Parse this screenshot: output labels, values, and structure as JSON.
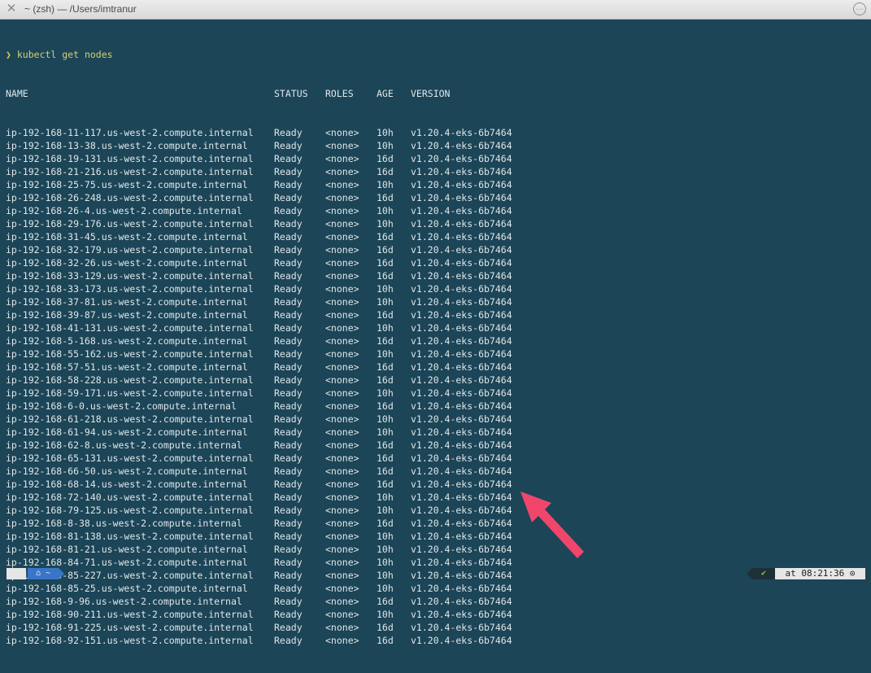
{
  "window": {
    "title": "~ (zsh) — /Users/imtranur",
    "close_glyph": "✕",
    "more_glyph": "…"
  },
  "prompt": {
    "glyph": "❯",
    "command": "kubectl get nodes"
  },
  "table": {
    "headers": [
      "NAME",
      "STATUS",
      "ROLES",
      "AGE",
      "VERSION"
    ],
    "rows": [
      [
        "ip-192-168-11-117.us-west-2.compute.internal",
        "Ready",
        "<none>",
        "10h",
        "v1.20.4-eks-6b7464"
      ],
      [
        "ip-192-168-13-38.us-west-2.compute.internal",
        "Ready",
        "<none>",
        "10h",
        "v1.20.4-eks-6b7464"
      ],
      [
        "ip-192-168-19-131.us-west-2.compute.internal",
        "Ready",
        "<none>",
        "16d",
        "v1.20.4-eks-6b7464"
      ],
      [
        "ip-192-168-21-216.us-west-2.compute.internal",
        "Ready",
        "<none>",
        "16d",
        "v1.20.4-eks-6b7464"
      ],
      [
        "ip-192-168-25-75.us-west-2.compute.internal",
        "Ready",
        "<none>",
        "10h",
        "v1.20.4-eks-6b7464"
      ],
      [
        "ip-192-168-26-248.us-west-2.compute.internal",
        "Ready",
        "<none>",
        "16d",
        "v1.20.4-eks-6b7464"
      ],
      [
        "ip-192-168-26-4.us-west-2.compute.internal",
        "Ready",
        "<none>",
        "10h",
        "v1.20.4-eks-6b7464"
      ],
      [
        "ip-192-168-29-176.us-west-2.compute.internal",
        "Ready",
        "<none>",
        "10h",
        "v1.20.4-eks-6b7464"
      ],
      [
        "ip-192-168-31-45.us-west-2.compute.internal",
        "Ready",
        "<none>",
        "16d",
        "v1.20.4-eks-6b7464"
      ],
      [
        "ip-192-168-32-179.us-west-2.compute.internal",
        "Ready",
        "<none>",
        "16d",
        "v1.20.4-eks-6b7464"
      ],
      [
        "ip-192-168-32-26.us-west-2.compute.internal",
        "Ready",
        "<none>",
        "16d",
        "v1.20.4-eks-6b7464"
      ],
      [
        "ip-192-168-33-129.us-west-2.compute.internal",
        "Ready",
        "<none>",
        "16d",
        "v1.20.4-eks-6b7464"
      ],
      [
        "ip-192-168-33-173.us-west-2.compute.internal",
        "Ready",
        "<none>",
        "10h",
        "v1.20.4-eks-6b7464"
      ],
      [
        "ip-192-168-37-81.us-west-2.compute.internal",
        "Ready",
        "<none>",
        "10h",
        "v1.20.4-eks-6b7464"
      ],
      [
        "ip-192-168-39-87.us-west-2.compute.internal",
        "Ready",
        "<none>",
        "16d",
        "v1.20.4-eks-6b7464"
      ],
      [
        "ip-192-168-41-131.us-west-2.compute.internal",
        "Ready",
        "<none>",
        "10h",
        "v1.20.4-eks-6b7464"
      ],
      [
        "ip-192-168-5-168.us-west-2.compute.internal",
        "Ready",
        "<none>",
        "16d",
        "v1.20.4-eks-6b7464"
      ],
      [
        "ip-192-168-55-162.us-west-2.compute.internal",
        "Ready",
        "<none>",
        "10h",
        "v1.20.4-eks-6b7464"
      ],
      [
        "ip-192-168-57-51.us-west-2.compute.internal",
        "Ready",
        "<none>",
        "16d",
        "v1.20.4-eks-6b7464"
      ],
      [
        "ip-192-168-58-228.us-west-2.compute.internal",
        "Ready",
        "<none>",
        "16d",
        "v1.20.4-eks-6b7464"
      ],
      [
        "ip-192-168-59-171.us-west-2.compute.internal",
        "Ready",
        "<none>",
        "10h",
        "v1.20.4-eks-6b7464"
      ],
      [
        "ip-192-168-6-0.us-west-2.compute.internal",
        "Ready",
        "<none>",
        "16d",
        "v1.20.4-eks-6b7464"
      ],
      [
        "ip-192-168-61-218.us-west-2.compute.internal",
        "Ready",
        "<none>",
        "10h",
        "v1.20.4-eks-6b7464"
      ],
      [
        "ip-192-168-61-94.us-west-2.compute.internal",
        "Ready",
        "<none>",
        "10h",
        "v1.20.4-eks-6b7464"
      ],
      [
        "ip-192-168-62-8.us-west-2.compute.internal",
        "Ready",
        "<none>",
        "16d",
        "v1.20.4-eks-6b7464"
      ],
      [
        "ip-192-168-65-131.us-west-2.compute.internal",
        "Ready",
        "<none>",
        "16d",
        "v1.20.4-eks-6b7464"
      ],
      [
        "ip-192-168-66-50.us-west-2.compute.internal",
        "Ready",
        "<none>",
        "16d",
        "v1.20.4-eks-6b7464"
      ],
      [
        "ip-192-168-68-14.us-west-2.compute.internal",
        "Ready",
        "<none>",
        "16d",
        "v1.20.4-eks-6b7464"
      ],
      [
        "ip-192-168-72-140.us-west-2.compute.internal",
        "Ready",
        "<none>",
        "10h",
        "v1.20.4-eks-6b7464"
      ],
      [
        "ip-192-168-79-125.us-west-2.compute.internal",
        "Ready",
        "<none>",
        "10h",
        "v1.20.4-eks-6b7464"
      ],
      [
        "ip-192-168-8-38.us-west-2.compute.internal",
        "Ready",
        "<none>",
        "16d",
        "v1.20.4-eks-6b7464"
      ],
      [
        "ip-192-168-81-138.us-west-2.compute.internal",
        "Ready",
        "<none>",
        "10h",
        "v1.20.4-eks-6b7464"
      ],
      [
        "ip-192-168-81-21.us-west-2.compute.internal",
        "Ready",
        "<none>",
        "10h",
        "v1.20.4-eks-6b7464"
      ],
      [
        "ip-192-168-84-71.us-west-2.compute.internal",
        "Ready",
        "<none>",
        "10h",
        "v1.20.4-eks-6b7464"
      ],
      [
        "ip-192-168-85-227.us-west-2.compute.internal",
        "Ready",
        "<none>",
        "10h",
        "v1.20.4-eks-6b7464"
      ],
      [
        "ip-192-168-85-25.us-west-2.compute.internal",
        "Ready",
        "<none>",
        "10h",
        "v1.20.4-eks-6b7464"
      ],
      [
        "ip-192-168-9-96.us-west-2.compute.internal",
        "Ready",
        "<none>",
        "16d",
        "v1.20.4-eks-6b7464"
      ],
      [
        "ip-192-168-90-211.us-west-2.compute.internal",
        "Ready",
        "<none>",
        "10h",
        "v1.20.4-eks-6b7464"
      ],
      [
        "ip-192-168-91-225.us-west-2.compute.internal",
        "Ready",
        "<none>",
        "16d",
        "v1.20.4-eks-6b7464"
      ],
      [
        "ip-192-168-92-151.us-west-2.compute.internal",
        "Ready",
        "<none>",
        "16d",
        "v1.20.4-eks-6b7464"
      ]
    ]
  },
  "statusbar": {
    "apple_glyph": "",
    "dir_text": "⌂ ~",
    "check_glyph": "✔",
    "time_text": "at 08:21:36 ⊙"
  },
  "colors": {
    "background": "#1c4557",
    "annotation_arrow": "#f0466b"
  },
  "icons": [
    "close-icon",
    "more-icon",
    "apple-icon",
    "home-icon",
    "check-icon",
    "clock-icon",
    "annotation-arrow-icon"
  ]
}
